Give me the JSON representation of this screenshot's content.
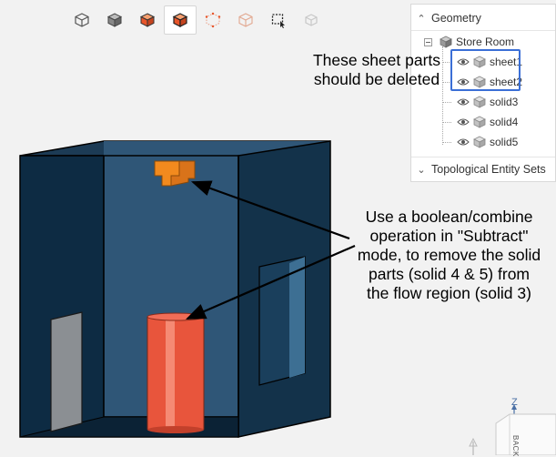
{
  "toolbar": {
    "buttons": [
      {
        "icon": "view-cube-outline-icon"
      },
      {
        "icon": "view-cube-solid-icon"
      },
      {
        "icon": "view-cube-orange-icon"
      },
      {
        "icon": "view-cube-active-icon",
        "active": true
      },
      {
        "icon": "view-cube-points-icon"
      },
      {
        "icon": "view-cube-faded-icon"
      },
      {
        "icon": "box-select-icon"
      },
      {
        "icon": "hide-icon"
      }
    ]
  },
  "panel": {
    "header": "Geometry",
    "root": "Store Room",
    "items": [
      {
        "label": "sheet1"
      },
      {
        "label": "sheet2"
      },
      {
        "label": "solid3"
      },
      {
        "label": "solid4"
      },
      {
        "label": "solid5"
      }
    ],
    "footer": "Topological Entity Sets"
  },
  "annotations": {
    "top_lines": [
      "These sheet parts",
      "should be deleted"
    ],
    "main_lines": [
      "Use a boolean/combine",
      "operation in \"Subtract\"",
      "mode, to remove the solid",
      "parts (solid 4 & 5) from",
      "the flow region (solid 3)"
    ]
  },
  "viewcube": {
    "axis": "Z",
    "face": "BACK"
  },
  "colors": {
    "room_front": "#0f2d45",
    "room_inner": "#2d5272",
    "cylinder": "#e8553c",
    "solid_orange": "#f28a1e",
    "highlight": "#3b6fd6"
  }
}
